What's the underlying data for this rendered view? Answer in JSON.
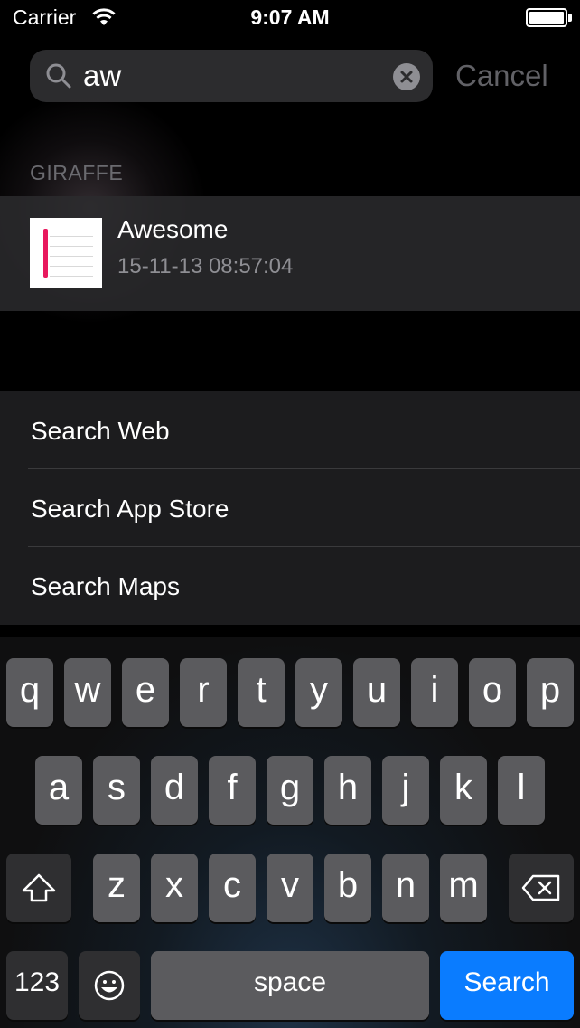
{
  "status_bar": {
    "carrier": "Carrier",
    "time": "9:07 AM",
    "wifi_icon": "wifi-icon",
    "battery_icon": "battery-icon"
  },
  "search": {
    "query": "aw",
    "cancel_label": "Cancel",
    "icon": "search-icon",
    "clear_icon": "clear-icon"
  },
  "results": {
    "section_title": "GIRAFFE",
    "items": [
      {
        "title": "Awesome",
        "subtitle": "15-11-13 08:57:04",
        "thumbnail_icon": "document-icon"
      }
    ]
  },
  "suggestions": [
    "Search Web",
    "Search App Store",
    "Search Maps"
  ],
  "keyboard": {
    "row1": [
      "q",
      "w",
      "e",
      "r",
      "t",
      "y",
      "u",
      "i",
      "o",
      "p"
    ],
    "row2": [
      "a",
      "s",
      "d",
      "f",
      "g",
      "h",
      "j",
      "k",
      "l"
    ],
    "row3": [
      "z",
      "x",
      "c",
      "v",
      "b",
      "n",
      "m"
    ],
    "numbers_label": "123",
    "space_label": "space",
    "search_label": "Search",
    "shift_icon": "shift-icon",
    "delete_icon": "delete-icon",
    "emoji_icon": "emoji-icon"
  },
  "colors": {
    "accent": "#0a7cff",
    "bookmark": "#e8195e"
  }
}
